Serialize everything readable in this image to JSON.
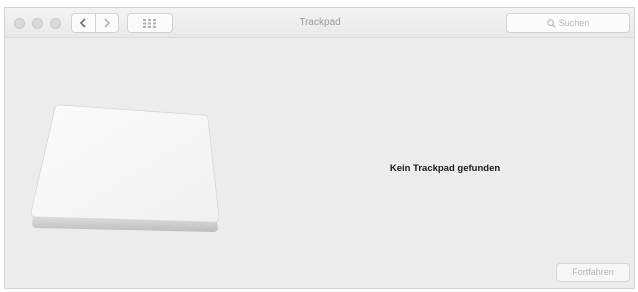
{
  "window": {
    "title": "Trackpad"
  },
  "toolbar": {
    "back_icon": "chevron-left-icon",
    "forward_icon": "chevron-right-icon",
    "show_all_icon": "grid-icon",
    "search_placeholder": "Suchen"
  },
  "main": {
    "message": "Kein Trackpad gefunden",
    "illustration_icon": "trackpad-icon",
    "continue_label": "Fortfahren"
  }
}
